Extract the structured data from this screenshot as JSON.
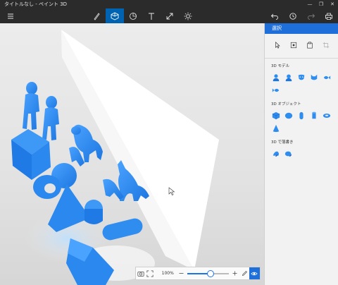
{
  "window": {
    "title": "タイトルなし - ペイント 3D",
    "controls": [
      "—",
      "❐",
      "✕"
    ]
  },
  "toolbar": {
    "tools": [
      "menu",
      "brushes",
      "3d-shapes",
      "stickers",
      "text",
      "effects-canvas",
      "effects"
    ],
    "active": "3d-shapes"
  },
  "panel": {
    "title": "選択",
    "sections": [
      {
        "title": "3D モデル",
        "count": 5
      },
      {
        "title": "3D オブジェクト",
        "count": 7
      },
      {
        "title": "3D で落書き",
        "count": 2
      }
    ]
  },
  "zoom": {
    "value_label": "100%",
    "level": 0.55
  },
  "colors": {
    "accent": "#1e6fd9",
    "model": "#2f8df0"
  }
}
